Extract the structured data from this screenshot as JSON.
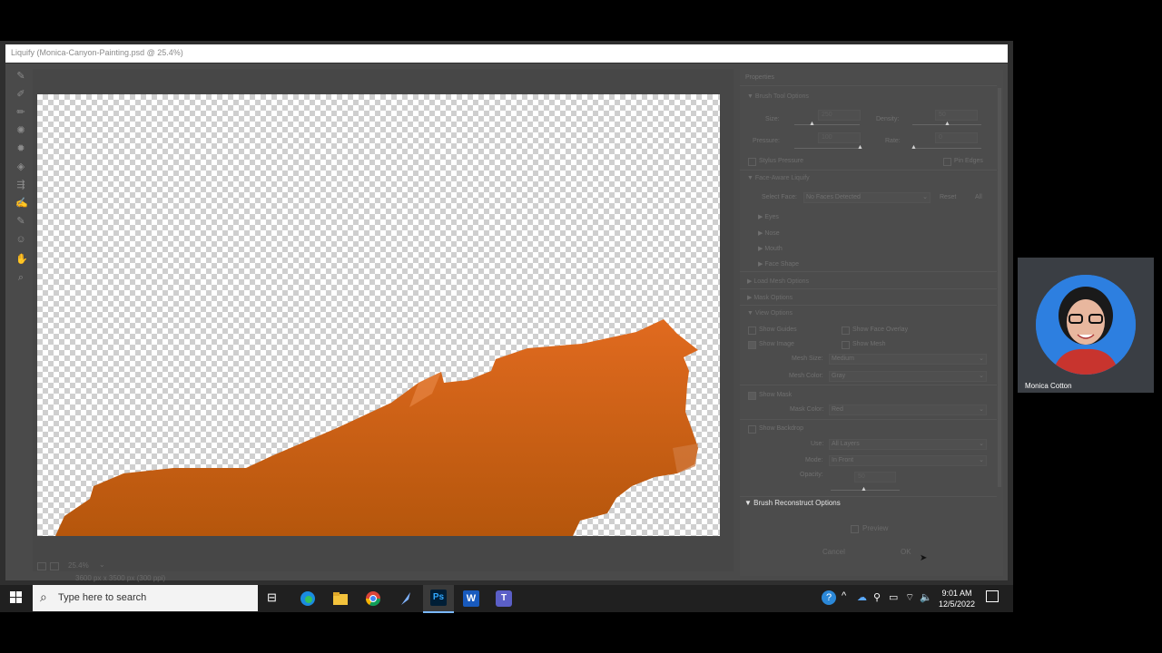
{
  "window": {
    "title": "Liquify (Monica-Canyon-Painting.psd @ 25.4%)"
  },
  "canvas_footer": {
    "zoom": "25.4%",
    "doc_info": "3600 px x 3500 px (300 ppi)"
  },
  "properties": {
    "header": "Properties",
    "brush_tool_options": {
      "title": "Brush Tool Options",
      "size_label": "Size:",
      "size_value": "250",
      "density_label": "Density:",
      "density_value": "50",
      "pressure_label": "Pressure:",
      "pressure_value": "100",
      "rate_label": "Rate:",
      "rate_value": "0",
      "stylus_pressure": "Stylus Pressure",
      "pin_edges": "Pin Edges"
    },
    "face_aware": {
      "title": "Face-Aware Liquify",
      "select_face_label": "Select Face:",
      "select_face_value": "No Faces Detected",
      "reset": "Reset",
      "all": "All",
      "eyes": "Eyes",
      "nose": "Nose",
      "mouth": "Mouth",
      "face_shape": "Face Shape"
    },
    "load_mesh": "Load Mesh Options",
    "mask_options": "Mask Options",
    "view_options": {
      "title": "View Options",
      "show_guides": "Show Guides",
      "show_face_overlay": "Show Face Overlay",
      "show_image": "Show Image",
      "show_mesh": "Show Mesh",
      "mesh_size_label": "Mesh Size:",
      "mesh_size_value": "Medium",
      "mesh_color_label": "Mesh Color:",
      "mesh_color_value": "Gray",
      "show_mask": "Show Mask",
      "mask_color_label": "Mask Color:",
      "mask_color_value": "Red",
      "show_backdrop": "Show Backdrop",
      "use_label": "Use:",
      "use_value": "All Layers",
      "mode_label": "Mode:",
      "mode_value": "In Front",
      "opacity_label": "Opacity:",
      "opacity_value": "50"
    },
    "brush_reconstruct": "Brush Reconstruct Options",
    "preview": "Preview",
    "cancel": "Cancel",
    "ok": "OK"
  },
  "taskbar": {
    "search_placeholder": "Type here to search",
    "time": "9:01 AM",
    "date": "12/5/2022"
  },
  "webcam": {
    "name": "Monica Cotton"
  },
  "colors": {
    "paint": "#d2651e",
    "photoshop": "#001e36",
    "accent": "#2d7fe0"
  }
}
